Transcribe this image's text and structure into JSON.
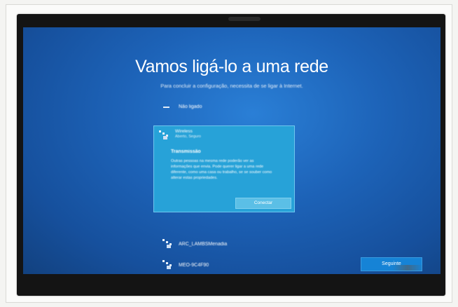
{
  "setup": {
    "title": "Vamos ligá-lo a uma rede",
    "subtitle": "Para concluir a configuração, necessita de se ligar à Internet."
  },
  "networks": [
    {
      "name": "Não ligado",
      "icon": "dash-icon"
    },
    {
      "name": "Wireless",
      "status": "Aberto, Seguro",
      "icon": "wifi-icon",
      "selected": true
    },
    {
      "name": "ARC_LAMBSMenadia",
      "icon": "wifi-icon"
    },
    {
      "name": "MEO-9C4F90",
      "icon": "wifi-icon"
    }
  ],
  "tooltip": {
    "title": "Transmissão",
    "body": "Outras pessoas na mesma rede poderão ver as informações que envia. Pode querer ligar a uma rede diferente, como uma casa ou trabalho, se se souber como alterar estas propriedades."
  },
  "buttons": {
    "connect": "Conectar",
    "next": "Seguinte"
  },
  "colors": {
    "screen_blue": "#1d63b8",
    "selected_panel": "#27a2d8",
    "next_button": "#1683d6"
  }
}
